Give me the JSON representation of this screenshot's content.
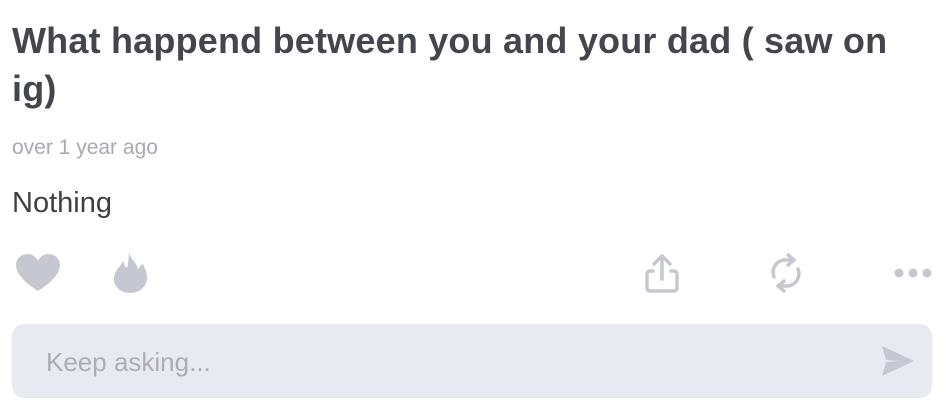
{
  "question": {
    "text": "What happend between you and your dad ( saw on ig)"
  },
  "timestamp": "over 1 year ago",
  "answer": "Nothing",
  "actions": {
    "like_icon": "heart-icon",
    "fire_icon": "fire-icon",
    "share_icon": "share-icon",
    "repost_icon": "repost-icon",
    "more_icon": "more-icon",
    "icon_color": "#c7c7d1"
  },
  "reply": {
    "placeholder": "Keep asking...",
    "value": "",
    "send_icon": "send-icon",
    "background": "#e9e9f2"
  }
}
